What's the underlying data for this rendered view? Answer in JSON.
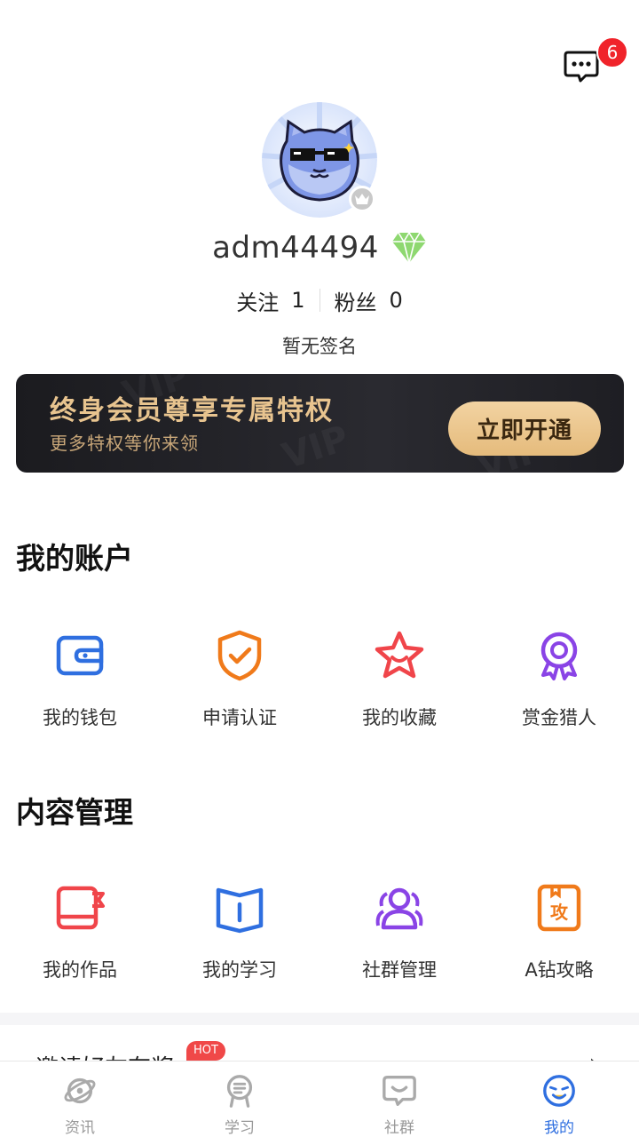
{
  "header": {
    "message_badge": "6"
  },
  "profile": {
    "username": "adm44494",
    "follow_label": "关注",
    "follow_count": "1",
    "fans_label": "粉丝",
    "fans_count": "0",
    "signature": "暂无签名"
  },
  "vip": {
    "title": "终身会员尊享专属特权",
    "subtitle": "更多特权等你来领",
    "button": "立即开通",
    "watermark": "VIP"
  },
  "account": {
    "title": "我的账户",
    "items": [
      {
        "label": "我的钱包",
        "icon": "wallet-icon"
      },
      {
        "label": "申请认证",
        "icon": "shield-check-icon"
      },
      {
        "label": "我的收藏",
        "icon": "star-icon"
      },
      {
        "label": "赏金猎人",
        "icon": "medal-icon"
      }
    ]
  },
  "content": {
    "title": "内容管理",
    "items": [
      {
        "label": "我的作品",
        "icon": "works-icon"
      },
      {
        "label": "我的学习",
        "icon": "book-icon"
      },
      {
        "label": "社群管理",
        "icon": "group-icon"
      },
      {
        "label": "A钻攻略",
        "icon": "guide-icon"
      }
    ]
  },
  "invite": {
    "label": "邀请好友有奖",
    "badge": "HOT"
  },
  "tabbar": {
    "tabs": [
      {
        "label": "资讯",
        "icon": "news-icon"
      },
      {
        "label": "学习",
        "icon": "study-icon"
      },
      {
        "label": "社群",
        "icon": "community-icon"
      },
      {
        "label": "我的",
        "icon": "profile-icon"
      }
    ],
    "active_index": 3
  },
  "colors": {
    "accent": "#2f6fe0",
    "badge": "#f0232a",
    "vip_gold": "#e8c48f",
    "diamond": "#7fd06a"
  }
}
